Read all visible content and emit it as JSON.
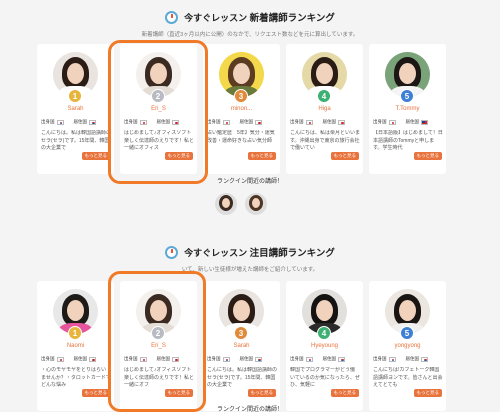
{
  "section1": {
    "title_prefix": "今すぐレッスン",
    "title_main": "新着講師ランキング",
    "subtitle": "新着講師（直近3ヶ月以内に公開）のなかで、リクエスト数などを元に算出しています。",
    "cards": [
      {
        "rank": "1",
        "name": "Sarah",
        "bio": "こんにちは。私は韓国語講師のセラ(セラ)です。15年間、韓国の大企業で",
        "more": "もっと見る",
        "hair": "#2b1d16",
        "bg": "#e9e4df",
        "shirt": "#fff"
      },
      {
        "rank": "2",
        "name": "Eri_S",
        "bio": "はじめまして♪オフィスソフト楽しく伝達師のえりです！私と一緒にオフィス",
        "more": "もっと見る",
        "hair": "#3a2a22",
        "bg": "#f3f0ee",
        "shirt": "#e4ddd6"
      },
      {
        "rank": "3",
        "name": "minon...",
        "bio": "占い鑑定歴　5年】気分・運気改善・運命好きな占い気分師",
        "more": "もっと見る",
        "hair": "#5b3b22",
        "bg": "#f2d84a",
        "shirt": "#6a7a3c"
      },
      {
        "rank": "4",
        "name": "Higa",
        "bio": "こんにちは、私は栗月といいます。沖縄出身で東京の旅行会社で働いてい",
        "more": "もっと見る",
        "hair": "#2a1c14",
        "bg": "#e6d9a8",
        "shirt": "#fff"
      },
      {
        "rank": "5",
        "name": "T.Tommy",
        "bio": "【日本語版】はじめまして！日本語講師のTommyと申します。学生時代",
        "more": "もっと見る",
        "hair": "#1c1614",
        "bg": "#7aa37a",
        "shirt": "#f5f5f5"
      }
    ],
    "origin_label": "出身国",
    "residence_label": "居住国"
  },
  "recent": {
    "label": "ランクイン間近の講師！"
  },
  "section2": {
    "title_prefix": "今すぐレッスン",
    "title_main": "注目講師ランキング",
    "subtitle": "いて、新しい生徒様が増えた講師をご紹介しています。",
    "cards": [
      {
        "rank": "1",
        "name": "Naomi",
        "bio": "・心のモヤモヤをとりはらいませんか？・タロットカードでどんな悩み",
        "more": "もっと見る",
        "hair": "#1e1a18",
        "bg": "#e8e8e8",
        "shirt": "#e7569c"
      },
      {
        "rank": "2",
        "name": "Eri_S",
        "bio": "はじめまして♪オフィスソフト楽しく伝達師のえりです！私と一緒にオフ",
        "more": "もっと見る",
        "hair": "#3a2a22",
        "bg": "#f3f0ee",
        "shirt": "#e4ddd6"
      },
      {
        "rank": "3",
        "name": "Sarah",
        "bio": "こんにちは。私は韓国語講師のセラ(セラ)です。15年間、韓国の大企業で",
        "more": "もっと見る",
        "hair": "#2b1d16",
        "bg": "#e9e4df",
        "shirt": "#fff"
      },
      {
        "rank": "4",
        "name": "Hyeyoung",
        "bio": "韓国でプログラマーがどう働いているのか気になったら、ぜひ、気軽に",
        "more": "もっと見る",
        "hair": "#151212",
        "bg": "#e2e0dc",
        "shirt": "#2a2a2a"
      },
      {
        "rank": "5",
        "name": "yongyong",
        "bio": "こんにちは!カフェトーク韓国語講師ヨンです。皆さんと出会えてとても",
        "more": "もっと見る",
        "hair": "#1a1512",
        "bg": "#ebe6e0",
        "shirt": "#f0f0f0"
      }
    ],
    "origin_label": "出身国",
    "residence_label": "居住国"
  },
  "footer_hint": "ランクイン間近の講師！",
  "colors": {
    "accent": "#e8733d",
    "highlight": "#f07a28"
  }
}
